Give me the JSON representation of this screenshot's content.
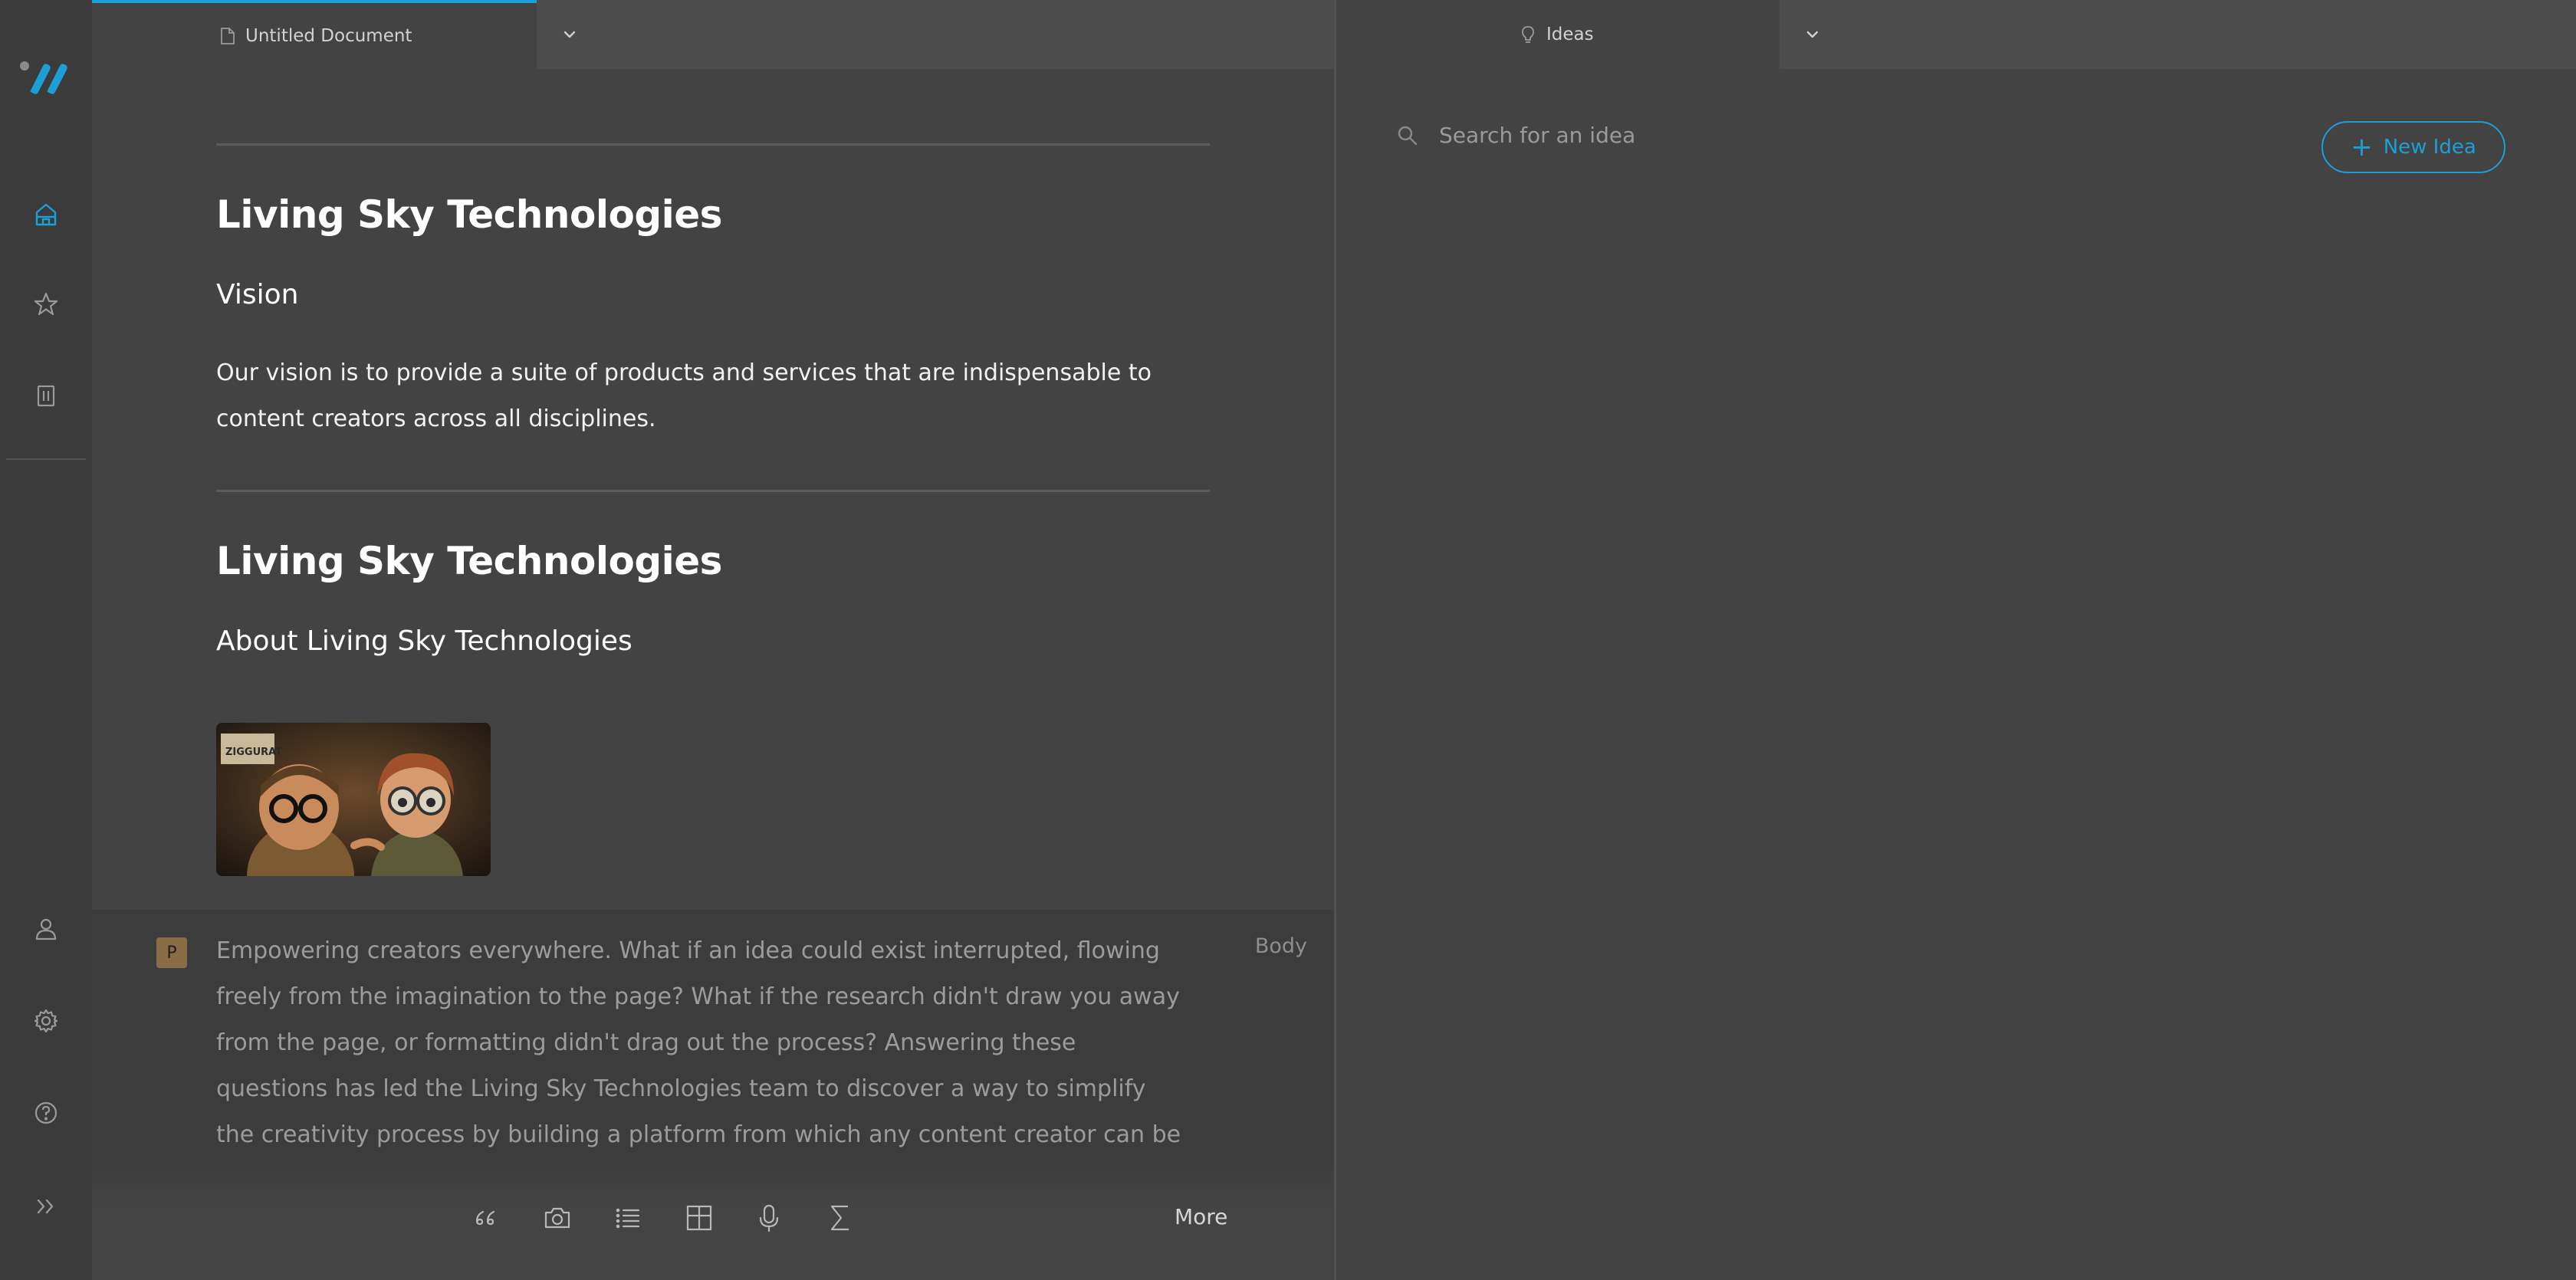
{
  "colors": {
    "accent": "#1b9fd6",
    "background": "#434343",
    "rail": "#3b3b3b",
    "active_block": "#3c3c3c",
    "badge": "#8a6d47"
  },
  "rail": {
    "logo_icon": "app-logo",
    "top_items": [
      {
        "icon": "home-icon",
        "active": true
      },
      {
        "icon": "star-icon",
        "active": false
      },
      {
        "icon": "trash-icon",
        "active": false
      }
    ],
    "bottom_items": [
      {
        "icon": "user-icon"
      },
      {
        "icon": "gear-icon"
      },
      {
        "icon": "help-icon"
      },
      {
        "icon": "expand-icon"
      }
    ]
  },
  "document": {
    "tab_title": "Untitled Document",
    "sections": [
      {
        "heading": "Living Sky Technologies",
        "subheading": "Vision",
        "body": "Our vision is to provide a suite of products and services that are indispensable to content creators across all disciplines."
      },
      {
        "heading": "Living Sky Technologies",
        "subheading": "About Living Sky Technologies"
      }
    ],
    "active_block": {
      "badge": "P",
      "style_label": "Body",
      "text": "Empowering creators everywhere. What if an idea could exist interrupted, flowing freely from the imagination to the page? What if the research didn't draw you away from the page, or formatting didn't drag out the process? Answering these questions has led the Living Sky Technologies team to discover a way to simplify the creativity process by building a platform from which any content creator can be launched"
    },
    "image_sign": "ZIGGURAT",
    "toolbar": {
      "tools": [
        "quote-icon",
        "camera-icon",
        "list-icon",
        "table-icon",
        "microphone-icon",
        "sigma-icon"
      ],
      "more_label": "More"
    }
  },
  "ideas": {
    "tab_title": "Ideas",
    "search_placeholder": "Search for an idea",
    "new_idea_label": "New Idea"
  }
}
